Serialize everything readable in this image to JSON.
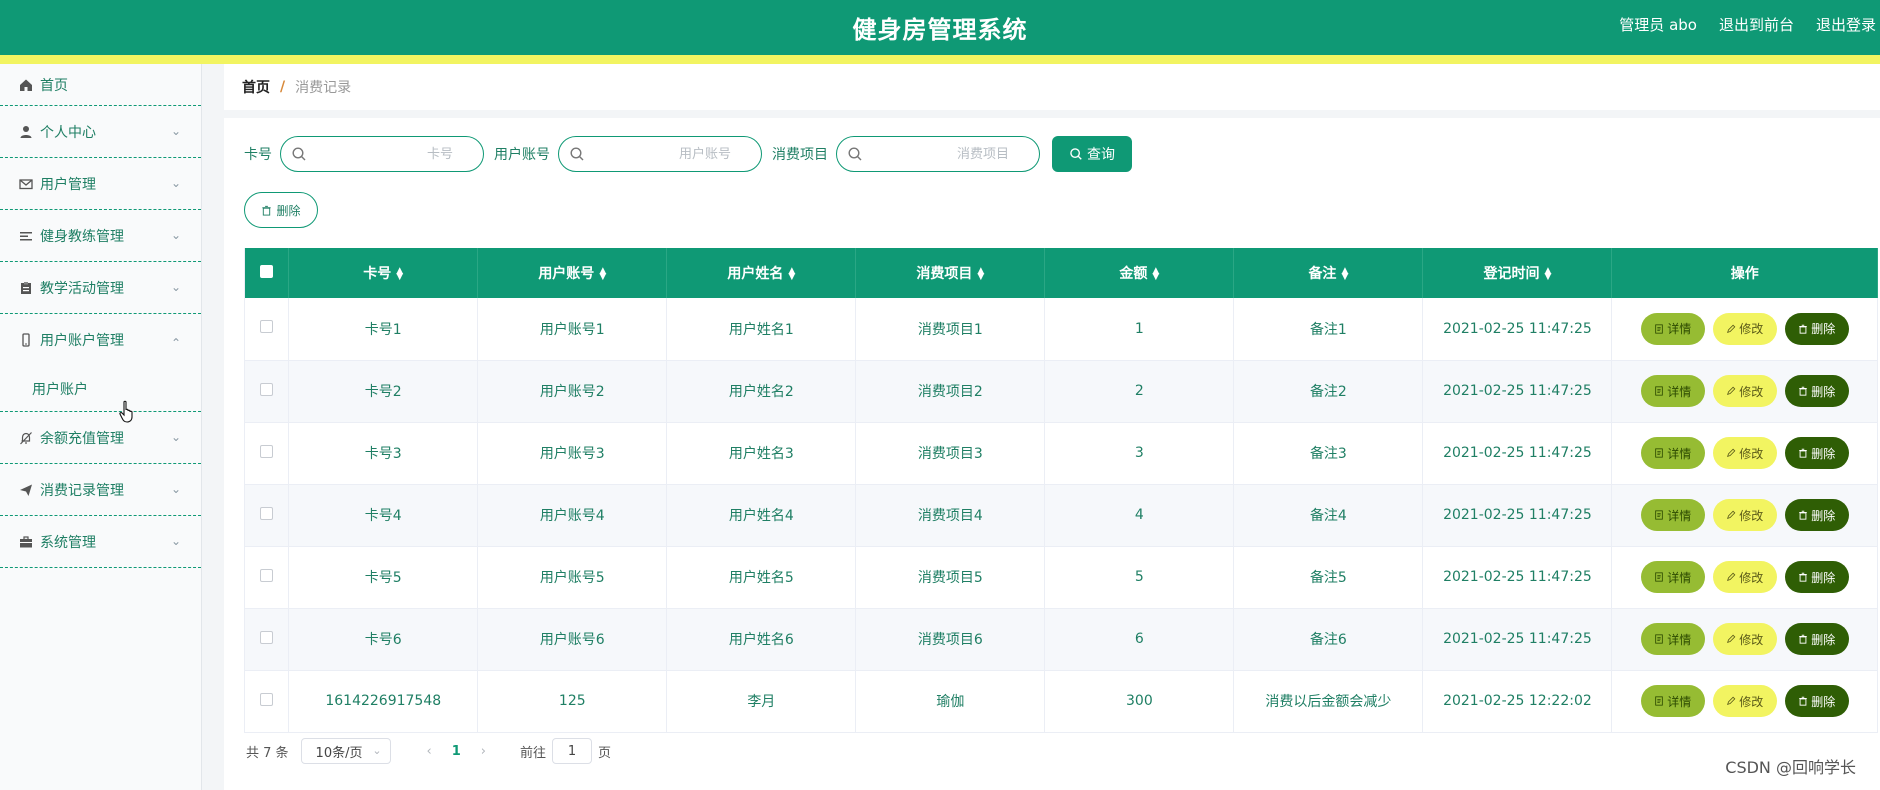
{
  "header": {
    "title": "健身房管理系统",
    "user": "管理员 abo",
    "to_front": "退出到前台",
    "logout": "退出登录"
  },
  "colors": {
    "primary": "#0f9975",
    "accent_yellow": "#f2f461",
    "detail": "#96bc33",
    "delete": "#2f5e05"
  },
  "sidebar": {
    "items": [
      {
        "label": "首页",
        "icon": "home-icon"
      },
      {
        "label": "个人中心",
        "icon": "user-icon"
      },
      {
        "label": "用户管理",
        "icon": "mail-icon"
      },
      {
        "label": "健身教练管理",
        "icon": "list-icon"
      },
      {
        "label": "教学活动管理",
        "icon": "clipboard-icon"
      },
      {
        "label": "用户账户管理",
        "icon": "mobile-icon",
        "expanded": true,
        "children": [
          "用户账户"
        ]
      },
      {
        "label": "余额充值管理",
        "icon": "bell-off-icon"
      },
      {
        "label": "消费记录管理",
        "icon": "send-icon"
      },
      {
        "label": "系统管理",
        "icon": "briefcase-icon"
      }
    ]
  },
  "breadcrumb": {
    "home": "首页",
    "separator": "/",
    "current": "消费记录"
  },
  "search": {
    "card_label": "卡号",
    "card_placeholder": "卡号",
    "account_label": "用户账号",
    "account_placeholder": "用户账号",
    "item_label": "消费项目",
    "item_placeholder": "消费项目",
    "query_button": "查询"
  },
  "delete_button": "删除",
  "table": {
    "columns": [
      "卡号",
      "用户账号",
      "用户姓名",
      "消费项目",
      "金额",
      "备注",
      "登记时间",
      "操作"
    ],
    "rows": [
      [
        "卡号1",
        "用户账号1",
        "用户姓名1",
        "消费项目1",
        "1",
        "备注1",
        "2021-02-25 11:47:25"
      ],
      [
        "卡号2",
        "用户账号2",
        "用户姓名2",
        "消费项目2",
        "2",
        "备注2",
        "2021-02-25 11:47:25"
      ],
      [
        "卡号3",
        "用户账号3",
        "用户姓名3",
        "消费项目3",
        "3",
        "备注3",
        "2021-02-25 11:47:25"
      ],
      [
        "卡号4",
        "用户账号4",
        "用户姓名4",
        "消费项目4",
        "4",
        "备注4",
        "2021-02-25 11:47:25"
      ],
      [
        "卡号5",
        "用户账号5",
        "用户姓名5",
        "消费项目5",
        "5",
        "备注5",
        "2021-02-25 11:47:25"
      ],
      [
        "卡号6",
        "用户账号6",
        "用户姓名6",
        "消费项目6",
        "6",
        "备注6",
        "2021-02-25 11:47:25"
      ],
      [
        "1614226917548",
        "125",
        "李月",
        "瑜伽",
        "300",
        "消费以后金额会减少",
        "2021-02-25 12:22:02"
      ]
    ],
    "actions": {
      "detail": "详情",
      "edit": "修改",
      "delete": "删除"
    }
  },
  "pager": {
    "total": "共 7 条",
    "page_size": "10条/页",
    "current_page": "1",
    "goto_label": "前往",
    "goto_value": "1",
    "page_unit": "页"
  },
  "watermark": "CSDN @回响学长"
}
